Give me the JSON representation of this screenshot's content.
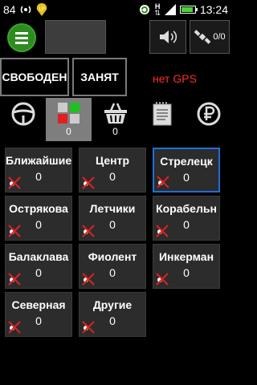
{
  "status_bar": {
    "left_number": "84",
    "time": "13:24",
    "network_type": "H",
    "icons": [
      "wireless-antenna-icon",
      "lp-badge-icon",
      "sync-icon",
      "network-arrows-icon",
      "signal-icon",
      "battery-icon"
    ],
    "battery_level": 0.9
  },
  "toolbar": {
    "menu_icon": "list-icon",
    "volume_icon": "speaker-icon",
    "satellite_icon": "satellite-icon",
    "satellite_count": "0/0"
  },
  "controls": {
    "free_label": "СВОБОДЕН",
    "busy_label": "ЗАНЯТ",
    "gps_status": "нет GPS"
  },
  "tabs": [
    {
      "icon": "steering-wheel-icon",
      "count": ""
    },
    {
      "icon": "squares-grid-icon",
      "count": "0"
    },
    {
      "icon": "basket-icon",
      "count": "0"
    },
    {
      "icon": "notepad-icon",
      "count": ""
    },
    {
      "icon": "ruble-icon",
      "count": ""
    }
  ],
  "districts": [
    {
      "name": "Ближайшие",
      "count": "0"
    },
    {
      "name": "Центр",
      "count": "0"
    },
    {
      "name": "Стрелецк",
      "count": "0"
    },
    {
      "name": "Острякова",
      "count": "0"
    },
    {
      "name": "Летчики",
      "count": "0"
    },
    {
      "name": "Корабельн",
      "count": "0"
    },
    {
      "name": "Балаклава",
      "count": "0"
    },
    {
      "name": "Фиолент",
      "count": "0"
    },
    {
      "name": "Инкерман",
      "count": "0"
    },
    {
      "name": "Северная",
      "count": "0"
    },
    {
      "name": "Другие",
      "count": "0"
    }
  ],
  "colors": {
    "accent_green": "#2e8b1f",
    "gps_red": "#ff2a2a",
    "selected_border": "#1e6fd9"
  }
}
